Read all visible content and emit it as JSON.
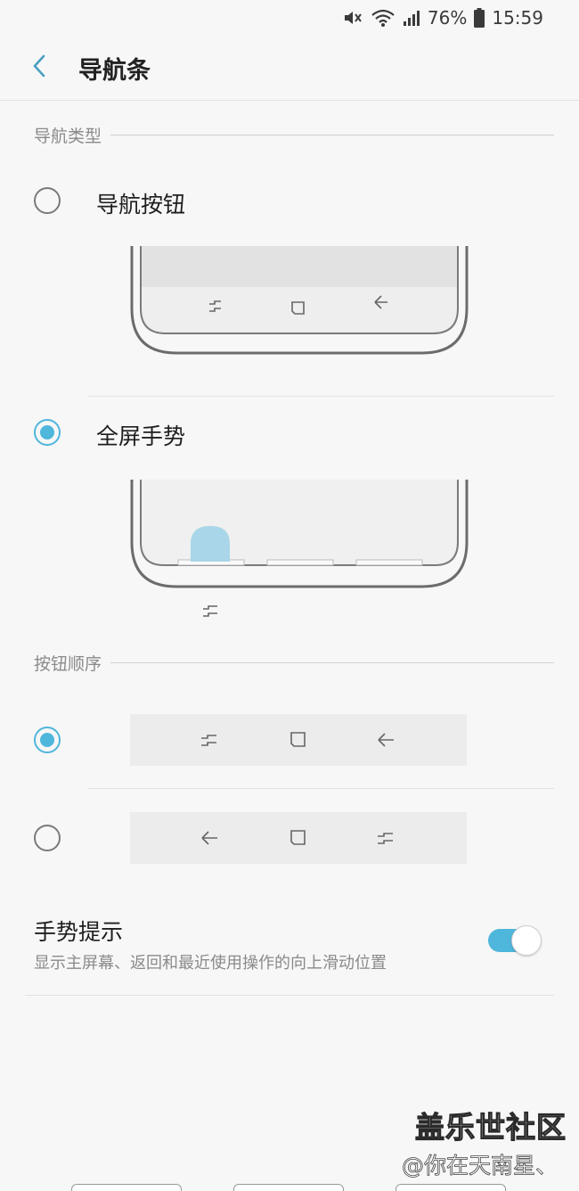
{
  "status_bar": {
    "battery": "76%",
    "time": "15:59",
    "icons": [
      "mute-icon",
      "wifi-icon",
      "signal-icon",
      "battery-icon"
    ]
  },
  "header": {
    "title": "导航条",
    "back_icon": "chevron-left-icon"
  },
  "navigation_type": {
    "section_title": "导航类型",
    "options": [
      {
        "label": "导航按钮",
        "selected": false
      },
      {
        "label": "全屏手势",
        "selected": true
      }
    ]
  },
  "button_order": {
    "section_title": "按钮顺序",
    "options": [
      {
        "selected": true,
        "icons": [
          "recent-apps-icon",
          "home-icon",
          "back-icon"
        ]
      },
      {
        "selected": false,
        "icons": [
          "back-icon",
          "home-icon",
          "recent-apps-icon"
        ]
      }
    ]
  },
  "gesture_hint": {
    "title": "手势提示",
    "description": "显示主屏幕、返回和最近使用操作的向上滑动位置",
    "enabled": true
  },
  "watermark": {
    "main": "盖乐世社区",
    "sub": "@你在天南星、"
  },
  "colors": {
    "accent": "#4fb6dc",
    "background": "#f7f7f7"
  }
}
